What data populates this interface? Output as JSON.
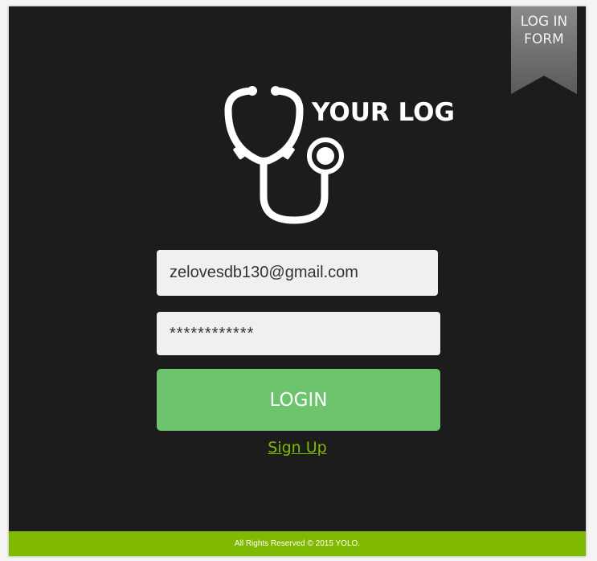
{
  "ribbon": {
    "line1": "LOG IN",
    "line2": "FORM"
  },
  "logo": {
    "text": "YOUR LOG",
    "icon": "stethoscope-icon"
  },
  "form": {
    "email_value": "zelovesdb130@gmail.com",
    "password_value": "************",
    "login_label": "LOGIN",
    "signup_label": "Sign Up"
  },
  "footer": {
    "text": "All Rights Reserved © 2015 YOLO."
  },
  "colors": {
    "background": "#1c1c1c",
    "accent_green": "#7fba00",
    "button_green": "#6cc46c",
    "ribbon_gray": "#707070"
  }
}
